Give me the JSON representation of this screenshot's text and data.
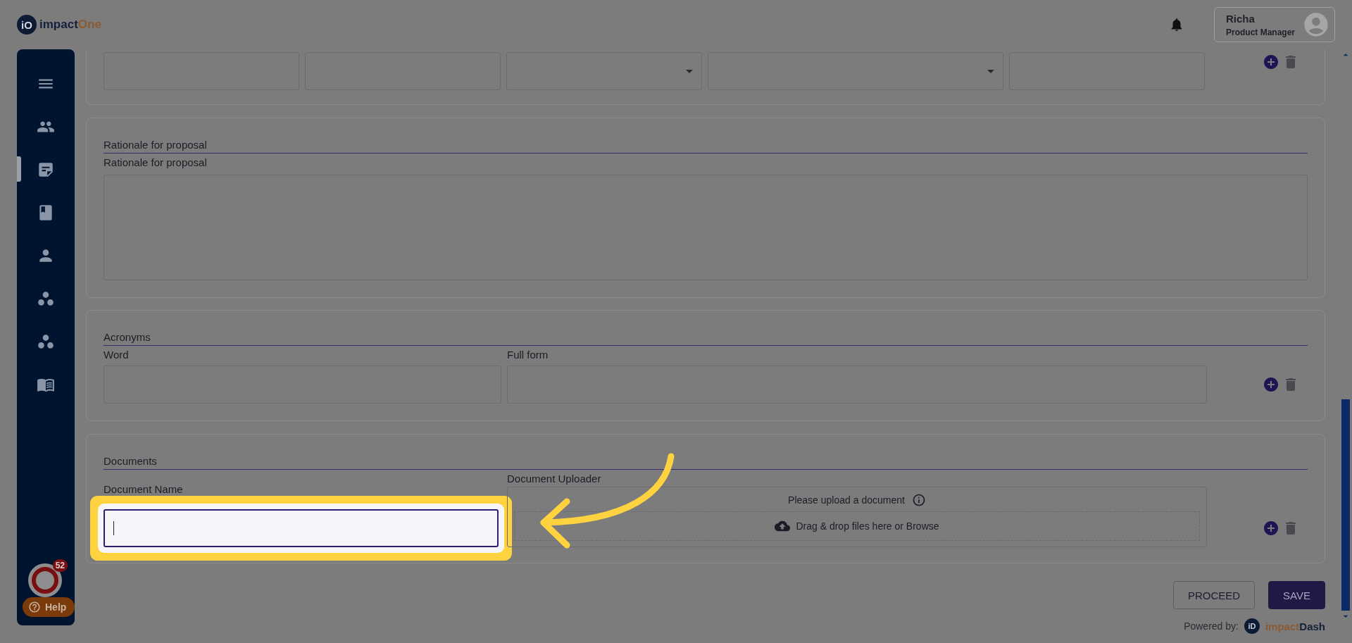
{
  "header": {
    "logo_mark": "iO",
    "logo_first": "impact",
    "logo_second": "One",
    "user": {
      "name": "Richa",
      "role": "Product Manager"
    }
  },
  "sidebar": {
    "items": [
      {
        "kind": "menu",
        "selected": false
      },
      {
        "kind": "people",
        "selected": false
      },
      {
        "kind": "note",
        "selected": true
      },
      {
        "kind": "book",
        "selected": false
      },
      {
        "kind": "person",
        "selected": false
      },
      {
        "kind": "circles",
        "selected": false
      },
      {
        "kind": "circles",
        "selected": false
      },
      {
        "kind": "open-book",
        "selected": false
      }
    ],
    "chat_badge": "52",
    "help": "Help"
  },
  "top_row": {
    "fields": [
      {
        "kind": "text"
      },
      {
        "kind": "text"
      },
      {
        "kind": "select"
      },
      {
        "kind": "select"
      },
      {
        "kind": "text"
      }
    ]
  },
  "rationale": {
    "title": "Rationale for proposal",
    "label": "Rationale for proposal"
  },
  "acronyms": {
    "title": "Acronyms",
    "columns": [
      "Word",
      "Full form"
    ]
  },
  "documents": {
    "title": "Documents",
    "name_label": "Document Name",
    "name_focused": true,
    "uploader_label": "Document Uploader",
    "upload_prompt": "Please upload a document",
    "drop_text": "Drag & drop files here or Browse"
  },
  "buttons": [
    {
      "kind": "outline",
      "label": "PROCEED"
    },
    {
      "kind": "primary",
      "label": "SAVE"
    }
  ],
  "footer": {
    "powered": "Powered by:",
    "brand_mark": "iD",
    "brand_first": "impact",
    "brand_second": "Dash"
  }
}
